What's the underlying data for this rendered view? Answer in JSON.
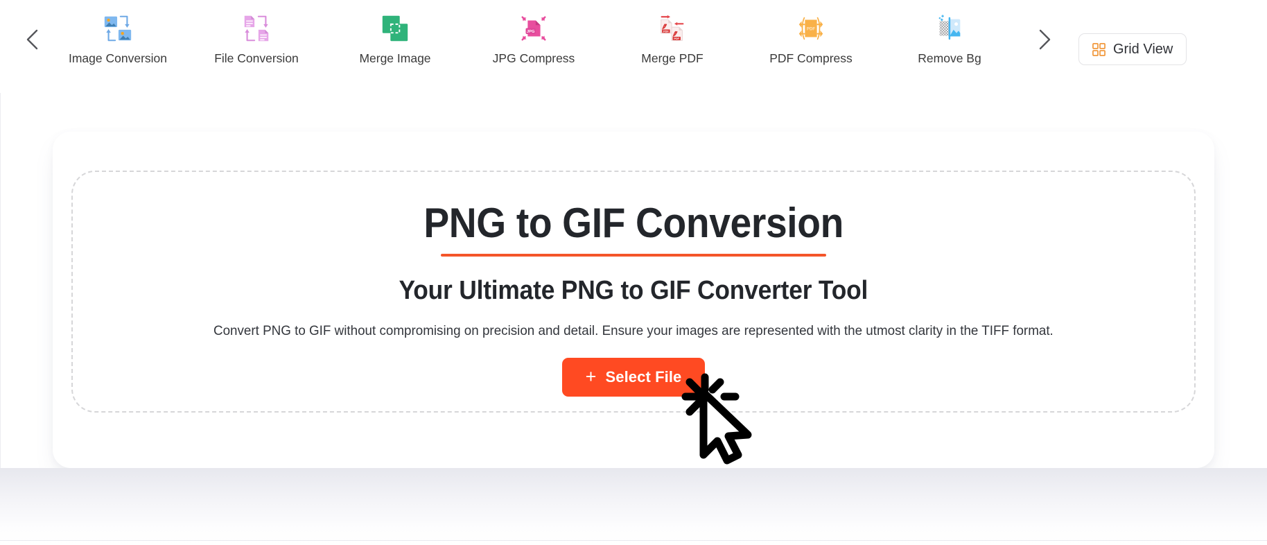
{
  "toolbar": {
    "prev_arrow": "chevron-left",
    "next_arrow": "chevron-right",
    "items": [
      {
        "label": "Image Conversion",
        "icon": "image-conversion-icon"
      },
      {
        "label": "File Conversion",
        "icon": "file-conversion-icon"
      },
      {
        "label": "Merge Image",
        "icon": "merge-image-icon"
      },
      {
        "label": "JPG Compress",
        "icon": "jpg-compress-icon"
      },
      {
        "label": "Merge PDF",
        "icon": "merge-pdf-icon"
      },
      {
        "label": "PDF Compress",
        "icon": "pdf-compress-icon"
      },
      {
        "label": "Remove Bg",
        "icon": "remove-bg-icon"
      }
    ],
    "grid_view": {
      "label": "Grid View",
      "icon": "grid-icon"
    }
  },
  "main": {
    "title": "PNG to GIF Conversion",
    "subtitle": "Your Ultimate PNG to GIF Converter Tool",
    "description": "Convert PNG to GIF without compromising on precision and detail. Ensure your images are represented with the utmost clarity in the TIFF format.",
    "select_file": {
      "label": "Select File",
      "plus_icon": "+"
    }
  },
  "colors": {
    "accent": "#ff4a22",
    "underline": "#f4552a",
    "heading": "#23262b",
    "body_text": "#33363c",
    "dropzone_border": "#d6d6d8",
    "page_bg": "#ffffff",
    "band_bg": "#e7e8ee"
  }
}
